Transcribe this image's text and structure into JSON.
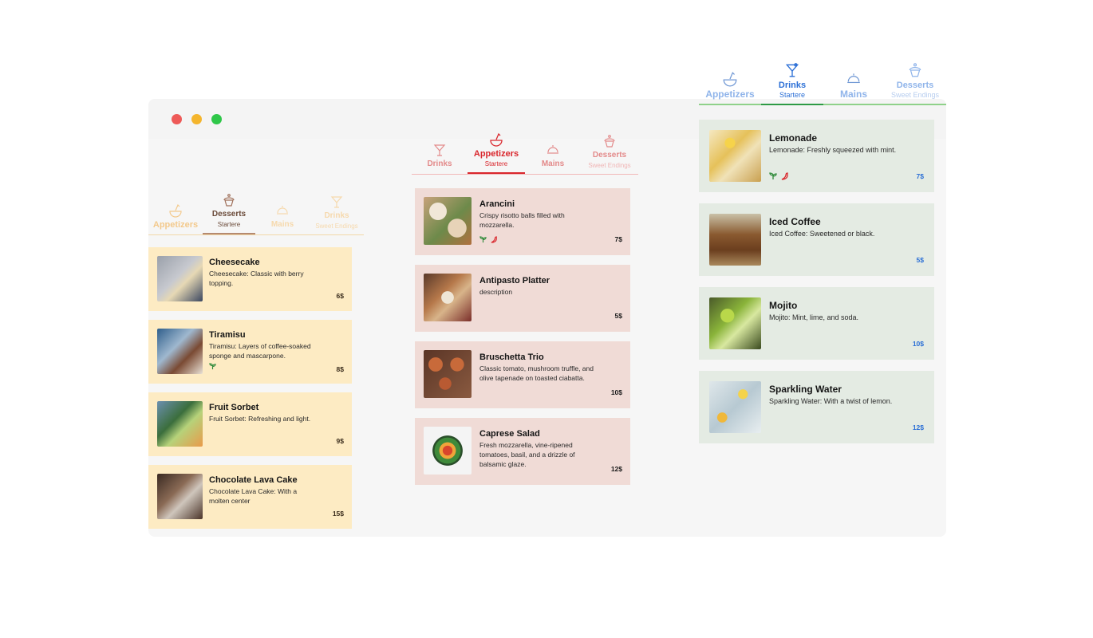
{
  "window": {
    "controls": [
      "close",
      "minimize",
      "maximize"
    ]
  },
  "menus": {
    "yellow": {
      "accent": "#f2c98a",
      "tabs": [
        {
          "label": "Appetizers",
          "sub": "",
          "icon": "bowl-icon"
        },
        {
          "label": "Desserts",
          "sub": "Startere",
          "icon": "cupcake-icon"
        },
        {
          "label": "Mains",
          "sub": "",
          "icon": "cloche-icon"
        },
        {
          "label": "Drinks",
          "sub": "Sweet Endings",
          "icon": "cocktail-icon"
        }
      ],
      "active_tab": 1,
      "items": [
        {
          "name": "Cheesecake",
          "description": "Cheesecake: Classic with berry topping.",
          "price": "6$",
          "tags": []
        },
        {
          "name": "Tiramisu",
          "description": "Tiramisu: Layers of coffee-soaked sponge and mascarpone.",
          "price": "8$",
          "tags": [
            "vegetarian"
          ]
        },
        {
          "name": "Fruit Sorbet",
          "description": "Fruit Sorbet: Refreshing and light.",
          "price": "9$",
          "tags": []
        },
        {
          "name": "Chocolate Lava Cake",
          "description": " Chocolate Lava Cake: With a molten center",
          "price": "15$",
          "tags": []
        }
      ]
    },
    "pink": {
      "accent": "#d9262c",
      "tabs": [
        {
          "label": "Drinks",
          "sub": "",
          "icon": "cocktail-icon"
        },
        {
          "label": "Appetizers",
          "sub": "Startere",
          "icon": "bowl-icon"
        },
        {
          "label": "Mains",
          "sub": "",
          "icon": "cloche-icon"
        },
        {
          "label": "Desserts",
          "sub": "Sweet Endings",
          "icon": "cupcake-icon"
        }
      ],
      "active_tab": 1,
      "items": [
        {
          "name": "Arancini",
          "description": "Crispy risotto balls filled with mozzarella.",
          "price": "7$",
          "tags": [
            "vegetarian",
            "spicy"
          ]
        },
        {
          "name": "Antipasto Platter",
          "description": "description",
          "price": "5$",
          "tags": []
        },
        {
          "name": "Bruschetta Trio",
          "description": "Classic tomato, mushroom truffle, and olive tapenade on toasted ciabatta.",
          "price": "10$",
          "tags": []
        },
        {
          "name": "Caprese Salad",
          "description": "Fresh mozzarella, vine-ripened tomatoes, basil, and a drizzle of balsamic glaze.",
          "price": "12$",
          "tags": []
        }
      ]
    },
    "green": {
      "accent": "#2b6fd6",
      "tabs": [
        {
          "label": "Appetizers",
          "sub": "",
          "icon": "bowl-icon"
        },
        {
          "label": "Drinks",
          "sub": "Startere",
          "icon": "cocktail-icon"
        },
        {
          "label": "Mains",
          "sub": "",
          "icon": "cloche-icon"
        },
        {
          "label": "Desserts",
          "sub": "Sweet Endings",
          "icon": "cupcake-icon"
        }
      ],
      "active_tab": 1,
      "items": [
        {
          "name": "Lemonade",
          "description": "Lemonade: Freshly squeezed with mint.",
          "price": "7$",
          "tags": [
            "vegetarian",
            "spicy"
          ]
        },
        {
          "name": "Iced Coffee",
          "description": "Iced Coffee: Sweetened or black.",
          "price": "5$",
          "tags": []
        },
        {
          "name": "Mojito",
          "description": "Mojito: Mint, lime, and soda.",
          "price": "10$",
          "tags": []
        },
        {
          "name": "Sparkling Water",
          "description": "Sparkling Water: With a twist of lemon.",
          "price": "12$",
          "tags": []
        }
      ]
    }
  }
}
